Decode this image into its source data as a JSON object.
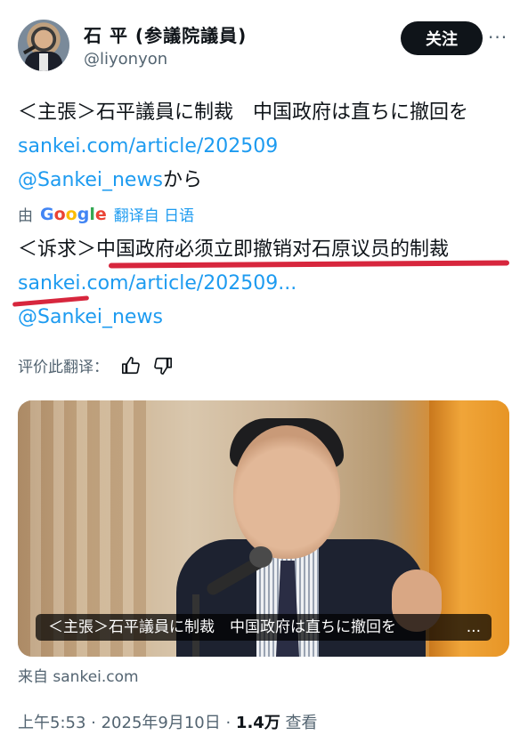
{
  "user": {
    "name": "石 平 (参議院議員)",
    "handle": "@liyonyon",
    "follow_label": "关注",
    "more_label": "···"
  },
  "post": {
    "original_text_1": "＜主張＞石平議員に制裁　中国政府は直ちに撤回を ",
    "original_link": "sankei.com/article/202509",
    "original_mention": "@Sankei_news",
    "original_suffix": "から"
  },
  "translation": {
    "by_label": "由",
    "google_text": "Google",
    "translated_from": "翻译自 日语",
    "text_prefix": "＜诉求＞",
    "text_highlight": "中国政府必须立即撤销对石原议员的制裁",
    "link": "sankei.com/article/202509...",
    "mention": "@Sankei_news",
    "rate_label": "评价此翻译："
  },
  "media": {
    "caption": "＜主張＞石平議員に制裁　中国政府は直ちに撤回を",
    "caption_more": "...",
    "source": "来自 sankei.com"
  },
  "meta": {
    "time": "上午5:53 · 2025年9月10日 · ",
    "views": "1.4万",
    "views_label": " 查看"
  },
  "icons": {
    "thumb_up": "thumb-up-icon",
    "thumb_down": "thumb-down-icon"
  },
  "colors": {
    "link": "#1d9bf0",
    "underline": "#d7263d"
  }
}
